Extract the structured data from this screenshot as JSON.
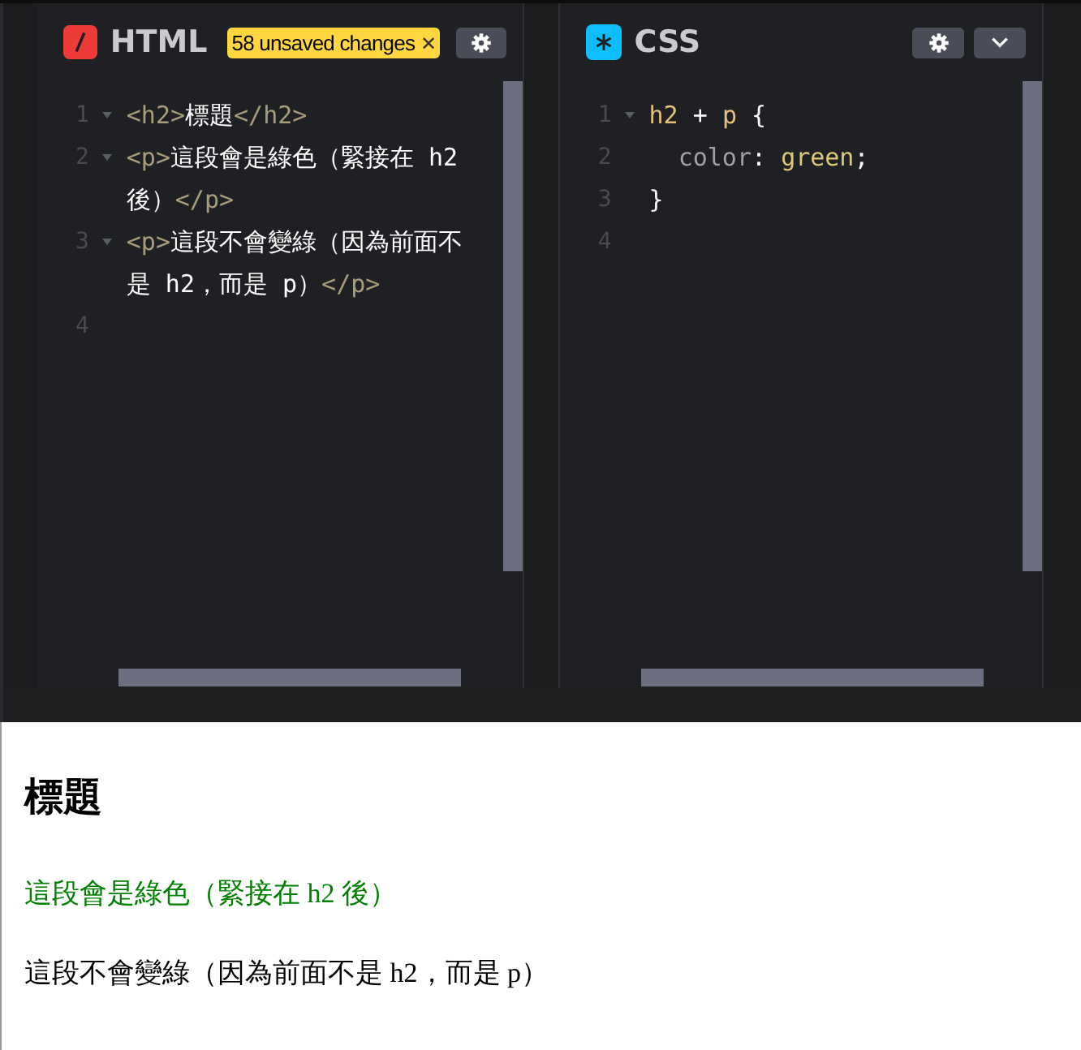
{
  "editors": [
    {
      "kind": "html",
      "title": "HTML",
      "badge": "58 unsaved changes",
      "close_glyph": "✕",
      "has_collapse": false,
      "lines": [
        {
          "number": "1",
          "fold": true,
          "rows": [
            [
              {
                "kind": "tag",
                "text": "<h2>"
              },
              {
                "kind": "text",
                "text": "標題"
              },
              {
                "kind": "tag",
                "text": "</h2>"
              }
            ]
          ]
        },
        {
          "number": "2",
          "fold": true,
          "rows": [
            [
              {
                "kind": "tag",
                "text": "<p>"
              },
              {
                "kind": "text",
                "text": "這段會是綠色（緊接在 h2"
              }
            ],
            [
              {
                "kind": "text",
                "text": "後）"
              },
              {
                "kind": "tag",
                "text": "</p>"
              }
            ]
          ]
        },
        {
          "number": "3",
          "fold": true,
          "rows": [
            [
              {
                "kind": "tag",
                "text": "<p>"
              },
              {
                "kind": "text",
                "text": "這段不會變綠（因為前面不"
              }
            ],
            [
              {
                "kind": "text",
                "text": "是 h2，而是 p）"
              },
              {
                "kind": "tag",
                "text": "</p>"
              }
            ]
          ]
        },
        {
          "number": "4",
          "fold": false,
          "rows": [
            []
          ]
        }
      ]
    },
    {
      "kind": "css",
      "title": "CSS",
      "has_collapse": true,
      "lines": [
        {
          "number": "1",
          "fold": true,
          "rows": [
            [
              {
                "kind": "selector",
                "text": "h2"
              },
              {
                "kind": "text",
                "text": " + "
              },
              {
                "kind": "selector",
                "text": "p"
              },
              {
                "kind": "text",
                "text": " {"
              }
            ]
          ]
        },
        {
          "number": "2",
          "fold": false,
          "rows": [
            [
              {
                "kind": "indent",
                "text": "  "
              },
              {
                "kind": "property",
                "text": "color"
              },
              {
                "kind": "text",
                "text": ": "
              },
              {
                "kind": "value",
                "text": "green"
              },
              {
                "kind": "text",
                "text": ";"
              }
            ]
          ]
        },
        {
          "number": "3",
          "fold": false,
          "rows": [
            [
              {
                "kind": "text",
                "text": "}"
              }
            ]
          ]
        },
        {
          "number": "4",
          "fold": false,
          "rows": [
            []
          ]
        }
      ]
    }
  ],
  "preview": [
    {
      "kind": "heading",
      "text": "標題",
      "color": "#000000"
    },
    {
      "kind": "paragraph",
      "text": "這段會是綠色（緊接在 h2 後）",
      "color": "#008000"
    },
    {
      "kind": "paragraph",
      "text": "這段不會變綠（因為前面不是 h2，而是 p）",
      "color": "#000000"
    }
  ]
}
